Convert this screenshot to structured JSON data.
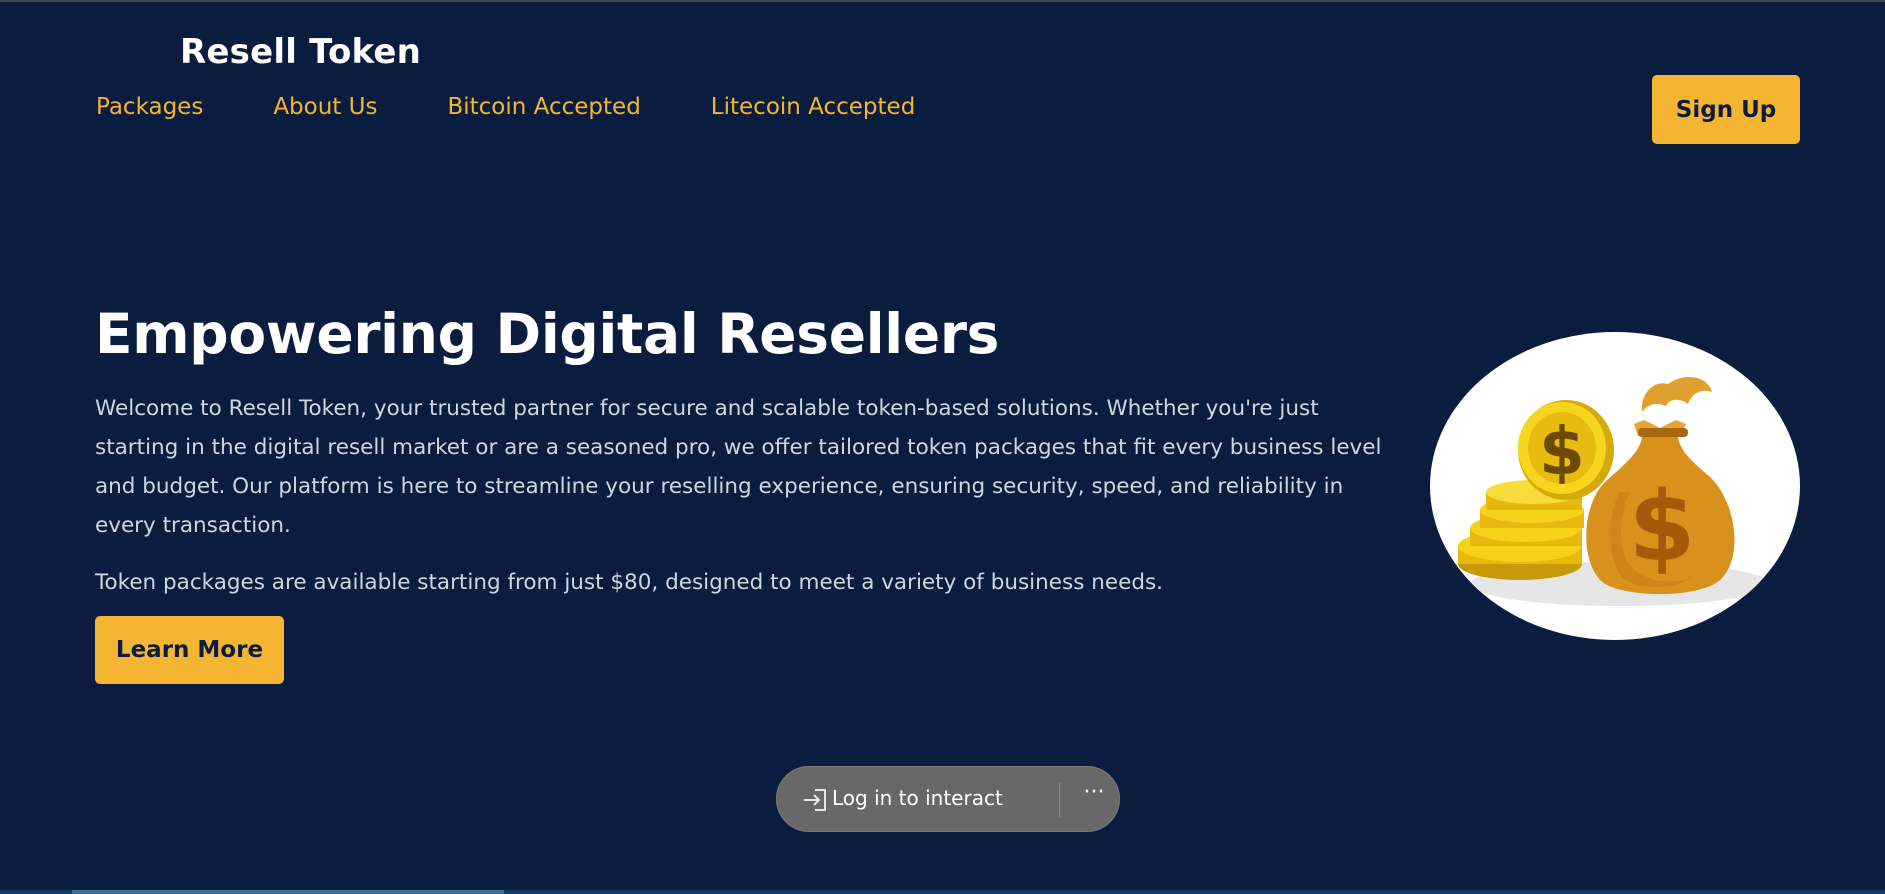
{
  "header": {
    "brand": "Resell Token",
    "nav": [
      "Packages",
      "About Us",
      "Bitcoin Accepted",
      "Litecoin Accepted"
    ],
    "signup_label": "Sign Up"
  },
  "hero": {
    "title": "Empowering Digital Resellers",
    "paragraph1": "Welcome to Resell Token, your trusted partner for secure and scalable token-based solutions. Whether you're just starting in the digital resell market or are a seasoned pro, we offer tailored token packages that fit every business level and budget. Our platform is here to streamline your reselling experience, ensuring security, speed, and reliability in every transaction.",
    "paragraph2": "Token packages are available starting from just $80, designed to meet a variety of business needs.",
    "learn_more_label": "Learn More",
    "image_icon": "money-bag-coins-icon"
  },
  "overlay": {
    "login_label": "Log in to interact",
    "more_icon": "more-dots-icon"
  },
  "colors": {
    "background": "#0b1d3f",
    "accent": "#f6b433",
    "text": "#ffffff",
    "body_text": "#cfd6e2",
    "pill": "#686868"
  }
}
